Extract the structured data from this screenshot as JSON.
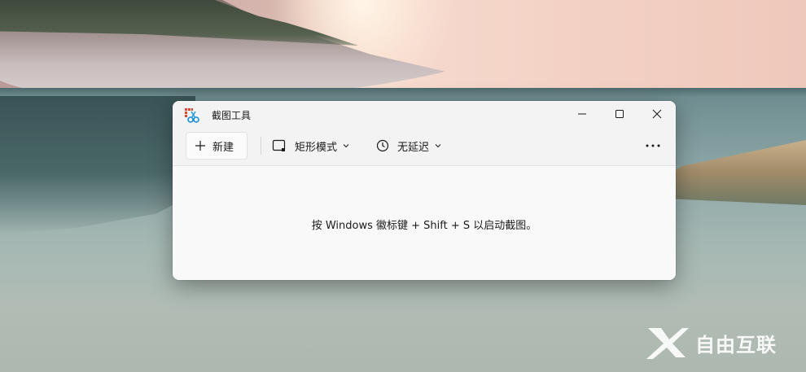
{
  "window": {
    "title": "截图工具",
    "controls": {
      "minimize": "minimize-icon",
      "maximize": "maximize-icon",
      "close": "close-icon"
    }
  },
  "toolbar": {
    "new_label": "新建",
    "mode_label": "矩形模式",
    "delay_label": "无延迟",
    "more_icon": "more-icon"
  },
  "content": {
    "hint": "按 Windows 徽标键 + Shift + S 以启动截图。"
  },
  "watermark": {
    "text": "自由互联"
  },
  "colors": {
    "window_bg": "#f9f9f9",
    "titlebar_bg": "#f3f3f3",
    "text": "#1a1a1a",
    "accent": "#0067c0"
  }
}
